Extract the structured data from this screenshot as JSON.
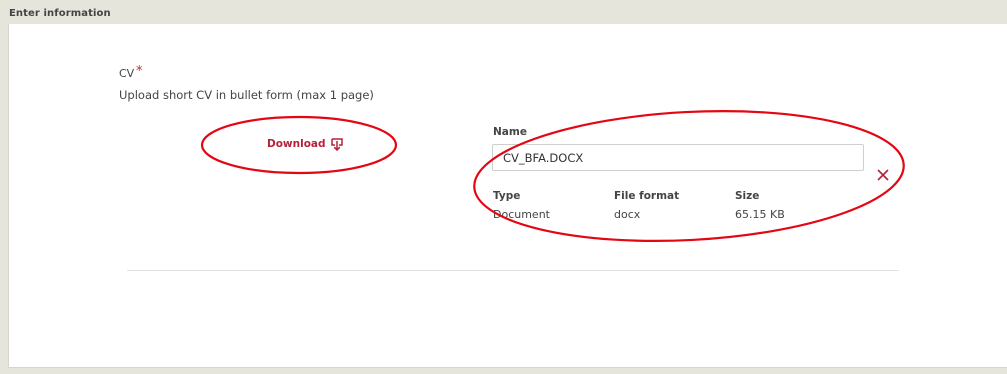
{
  "section": {
    "title": "Enter information"
  },
  "field": {
    "label": "CV",
    "required_marker": "*",
    "help_text": "Upload short CV in bullet form (max 1 page)"
  },
  "download": {
    "label": "Download",
    "icon": "download-icon"
  },
  "file": {
    "name_label": "Name",
    "name_value": "CV_BFA.DOCX",
    "type_label": "Type",
    "type_value": "Document",
    "format_label": "File format",
    "format_value": "docx",
    "size_label": "Size",
    "size_value": "65.15 KB",
    "remove_icon": "close-icon"
  },
  "colors": {
    "accent": "#b5213a",
    "required": "#c1272d",
    "annotation": "#e30613",
    "background": "#e6e5dc"
  }
}
